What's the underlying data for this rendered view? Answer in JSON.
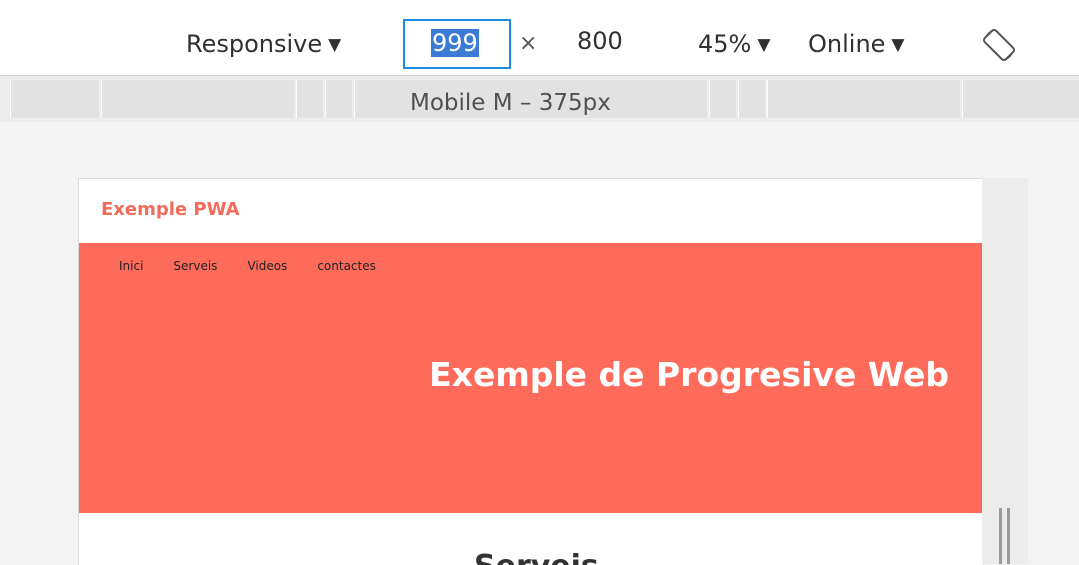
{
  "toolbar": {
    "device_mode": "Responsive",
    "width_value": "999",
    "times_symbol": "×",
    "height_value": "800",
    "zoom": "45%",
    "throttling": "Online",
    "dropdown_glyph": "▼"
  },
  "ruler": {
    "label": "Mobile M – 375px"
  },
  "site": {
    "brand": "Exemple PWA",
    "nav": [
      "Inici",
      "Serveis",
      "Videos",
      "contactes"
    ],
    "hero_title": "Exemple de Progresive Web",
    "section_title": "Serveis"
  },
  "icons": {
    "rotate": "rotate-icon",
    "resize": "resize-handle-icon"
  },
  "colors": {
    "accent": "#ff6b5b",
    "brand_text": "#f26b5b",
    "input_focus": "#1e88e5",
    "selection": "#3a7bd5"
  }
}
